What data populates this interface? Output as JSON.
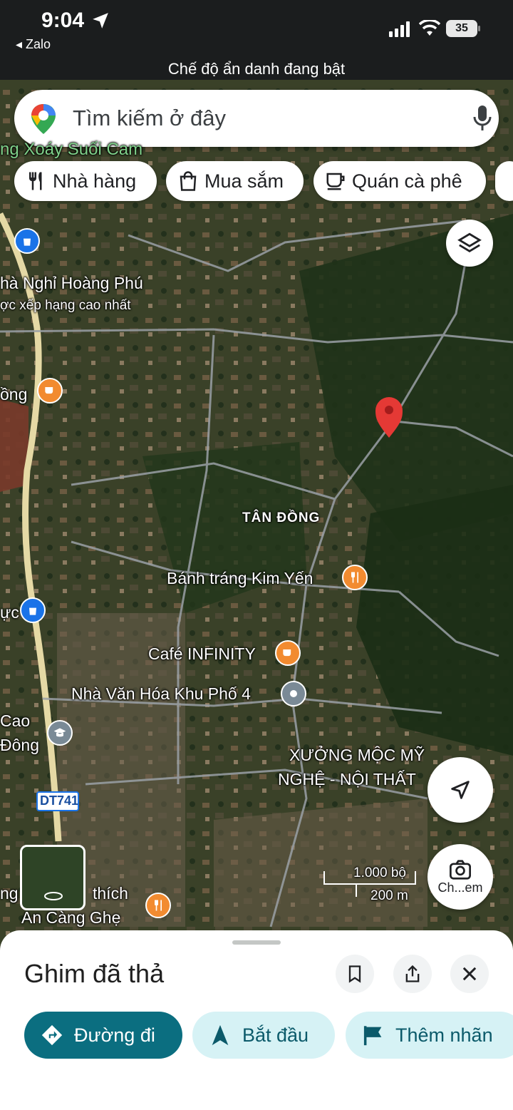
{
  "status_bar": {
    "time": "9:04",
    "back_app": "◂ Zalo",
    "battery": "35",
    "incognito_text": "Chế độ ẩn danh đang bật"
  },
  "search": {
    "placeholder": "Tìm kiếm ở đây"
  },
  "chips": [
    {
      "label": "Nhà hàng",
      "icon": "fork-knife-icon"
    },
    {
      "label": "Mua sắm",
      "icon": "shopping-bag-icon"
    },
    {
      "label": "Quán cà phê",
      "icon": "coffee-cup-icon"
    }
  ],
  "map": {
    "labels": {
      "top_green": "ng Xoáy Suối Cam",
      "hotel": "hà Nghỉ Hoàng Phú",
      "hotel_sub": "ợc xếp hạng cao nhất",
      "cafe_left": "ồng",
      "district": "TÂN ĐỒNG",
      "banh_trang": "Bánh tráng Kim Yến",
      "cafe_infinity": "Café INFINITY",
      "nha_van_hoa": "Nhà Văn Hóa Khu Phố 4",
      "shop_left": "ực",
      "school_1": "Cao",
      "school_2": "Đông",
      "workshop_1": "XƯỞNG MỘC MỸ",
      "workshop_2": "NGHỆ - NỘI THẤT",
      "road_shield": "DT741",
      "bottom_1": "ng",
      "bottom_2": "thích",
      "bottom_3": "An Càng Ghẹ",
      "scale_ft": "1.000 bộ",
      "scale_m": "200 m",
      "lens_label": "Ch...em"
    },
    "colors": {
      "pin": "#e53935",
      "cafe": "#f28b30",
      "shop": "#1a73e8",
      "school": "#7a8a96"
    }
  },
  "sheet": {
    "title": "Ghim đã thả",
    "actions": {
      "directions": "Đường đi",
      "start": "Bắt đầu",
      "label": "Thêm nhãn"
    }
  }
}
